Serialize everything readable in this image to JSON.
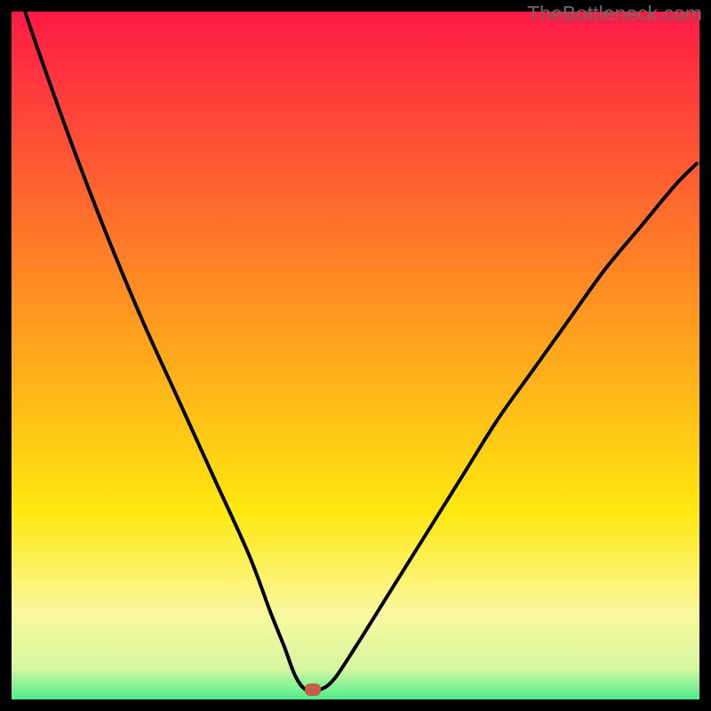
{
  "watermark": "TheBottleneck.com",
  "chart_data": {
    "type": "line",
    "title": "",
    "xlabel": "",
    "ylabel": "",
    "xlim": [
      0,
      100
    ],
    "ylim": [
      0,
      100
    ],
    "series": [
      {
        "name": "curve",
        "x": [
          3,
          5,
          10,
          15,
          20,
          25,
          30,
          35,
          38,
          40,
          41.5,
          43,
          45,
          47,
          50,
          55,
          60,
          65,
          70,
          75,
          80,
          85,
          90,
          95,
          98
        ],
        "y": [
          100,
          94,
          80,
          67,
          55,
          44,
          33,
          22,
          14,
          9,
          5,
          3,
          3,
          4.5,
          9,
          17,
          25,
          33,
          41,
          48,
          55,
          62,
          68,
          74,
          77
        ]
      }
    ],
    "marker": {
      "x": 44,
      "y": 3
    },
    "background_gradient": {
      "stops": [
        {
          "offset": 0.0,
          "color": "#ff1547"
        },
        {
          "offset": 0.45,
          "color": "#ff9a1f"
        },
        {
          "offset": 0.72,
          "color": "#ffe80f"
        },
        {
          "offset": 0.86,
          "color": "#fbf89e"
        },
        {
          "offset": 0.94,
          "color": "#d6f7a0"
        },
        {
          "offset": 1.0,
          "color": "#19e984"
        }
      ]
    },
    "frame": {
      "stroke": "#000000",
      "width": 26
    }
  }
}
